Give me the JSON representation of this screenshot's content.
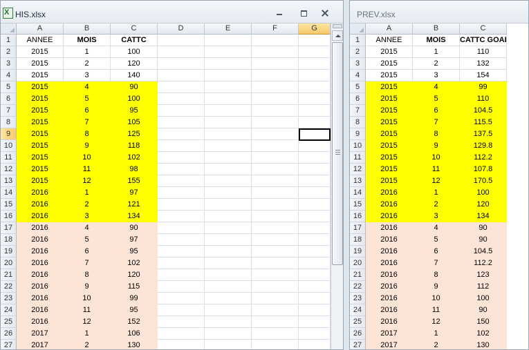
{
  "left": {
    "title": "HIS.xlsx",
    "columns": [
      "A",
      "B",
      "C",
      "D",
      "E",
      "F",
      "G"
    ],
    "selected_column": "G",
    "selected_row": 9,
    "header": [
      "ANNEE",
      "MOIS",
      "CATTC"
    ],
    "rows": [
      [
        "2015",
        "1",
        "100"
      ],
      [
        "2015",
        "2",
        "120"
      ],
      [
        "2015",
        "3",
        "140"
      ],
      [
        "2015",
        "4",
        "90"
      ],
      [
        "2015",
        "5",
        "100"
      ],
      [
        "2015",
        "6",
        "95"
      ],
      [
        "2015",
        "7",
        "105"
      ],
      [
        "2015",
        "8",
        "125"
      ],
      [
        "2015",
        "9",
        "118"
      ],
      [
        "2015",
        "10",
        "102"
      ],
      [
        "2015",
        "11",
        "98"
      ],
      [
        "2015",
        "12",
        "155"
      ],
      [
        "2016",
        "1",
        "97"
      ],
      [
        "2016",
        "2",
        "121"
      ],
      [
        "2016",
        "3",
        "134"
      ],
      [
        "2016",
        "4",
        "90"
      ],
      [
        "2016",
        "5",
        "97"
      ],
      [
        "2016",
        "6",
        "95"
      ],
      [
        "2016",
        "7",
        "102"
      ],
      [
        "2016",
        "8",
        "120"
      ],
      [
        "2016",
        "9",
        "115"
      ],
      [
        "2016",
        "10",
        "99"
      ],
      [
        "2016",
        "11",
        "95"
      ],
      [
        "2016",
        "12",
        "152"
      ],
      [
        "2017",
        "1",
        "106"
      ],
      [
        "2017",
        "2",
        "130"
      ]
    ]
  },
  "right": {
    "title": "PREV.xlsx",
    "columns": [
      "A",
      "B",
      "C"
    ],
    "header": [
      "ANNEE",
      "MOIS",
      "CATTC GOAL"
    ],
    "rows": [
      [
        "2015",
        "1",
        "110"
      ],
      [
        "2015",
        "2",
        "132"
      ],
      [
        "2015",
        "3",
        "154"
      ],
      [
        "2015",
        "4",
        "99"
      ],
      [
        "2015",
        "5",
        "110"
      ],
      [
        "2015",
        "6",
        "104.5"
      ],
      [
        "2015",
        "7",
        "115.5"
      ],
      [
        "2015",
        "8",
        "137.5"
      ],
      [
        "2015",
        "9",
        "129.8"
      ],
      [
        "2015",
        "10",
        "112.2"
      ],
      [
        "2015",
        "11",
        "107.8"
      ],
      [
        "2015",
        "12",
        "170.5"
      ],
      [
        "2016",
        "1",
        "100"
      ],
      [
        "2016",
        "2",
        "120"
      ],
      [
        "2016",
        "3",
        "134"
      ],
      [
        "2016",
        "4",
        "90"
      ],
      [
        "2016",
        "5",
        "90"
      ],
      [
        "2016",
        "6",
        "104.5"
      ],
      [
        "2016",
        "7",
        "112.2"
      ],
      [
        "2016",
        "8",
        "123"
      ],
      [
        "2016",
        "9",
        "112"
      ],
      [
        "2016",
        "10",
        "100"
      ],
      [
        "2016",
        "11",
        "90"
      ],
      [
        "2016",
        "12",
        "150"
      ],
      [
        "2017",
        "1",
        "102"
      ],
      [
        "2017",
        "2",
        "130"
      ]
    ]
  },
  "colors": {
    "highlight_yellow": "#ffff00",
    "highlight_peach": "#fce4d6"
  },
  "icons": {
    "excel_file": "excel-file-icon",
    "minimize": "minimize-icon",
    "restore": "restore-icon",
    "close": "close-icon"
  }
}
